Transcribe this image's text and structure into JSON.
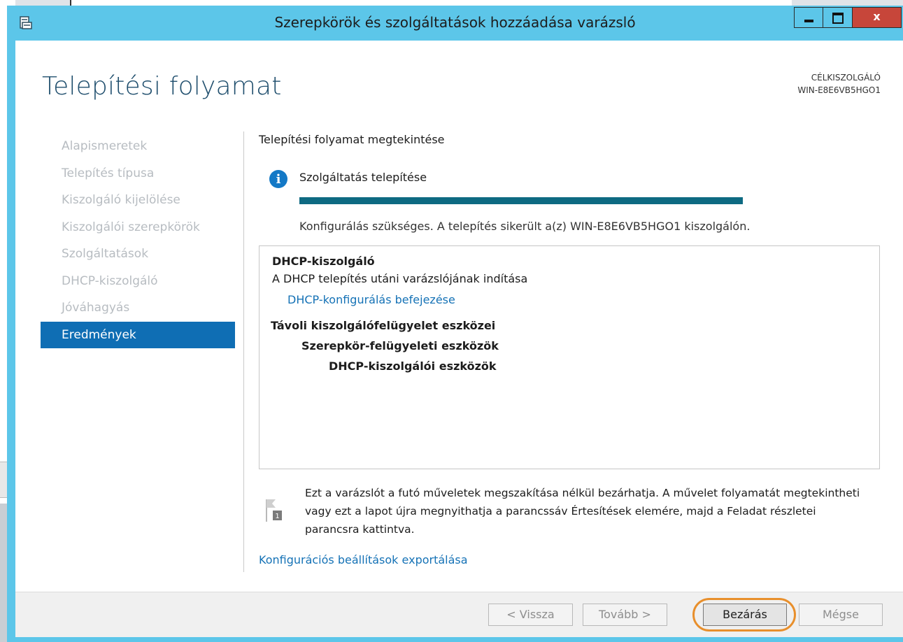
{
  "window": {
    "title": "Szerepkörök és szolgáltatások hozzáadása varázsló",
    "close_glyph": "x"
  },
  "page": {
    "heading": "Telepítési folyamat",
    "target_label": "CÉLKISZOLGÁLÓ",
    "target_server": "WIN-E8E6VB5HGO1"
  },
  "nav": {
    "items": [
      {
        "label": "Alapismeretek"
      },
      {
        "label": "Telepítés típusa"
      },
      {
        "label": "Kiszolgáló kijelölése"
      },
      {
        "label": "Kiszolgálói szerepkörök"
      },
      {
        "label": "Szolgáltatások"
      },
      {
        "label": "DHCP-kiszolgáló"
      },
      {
        "label": "Jóváhagyás"
      },
      {
        "label": "Eredmények"
      }
    ],
    "active_index": 7
  },
  "progress": {
    "section_title": "Telepítési folyamat megtekintése",
    "status": "Szolgáltatás telepítése",
    "fraction": 1.0,
    "result": "Konfigurálás szükséges. A telepítés sikerült a(z) WIN-E8E6VB5HGO1 kiszolgálón."
  },
  "results": {
    "dhcp_server": "DHCP-kiszolgáló",
    "post_install": "A DHCP telepítés utáni varázslójának indítása",
    "config_link": "DHCP-konfigurálás befejezése",
    "rsat": "Távoli kiszolgálófelügyelet eszközei",
    "role_tools": "Szerepkör-felügyeleti eszközök",
    "dhcp_tools": "DHCP-kiszolgálói eszközök"
  },
  "note": {
    "text": "Ezt a varázslót a futó műveletek megszakítása nélkül bezárhatja. A művelet folyamatát megtekintheti vagy ezt a lapot újra megnyithatja a parancssáv Értesítések elemére, majd a Feladat részletei parancsra kattintva.",
    "flag_badge": "1"
  },
  "export_link": "Konfigurációs beállítások exportálása",
  "footer": {
    "back": "< Vissza",
    "next": "Tovább >",
    "close": "Bezárás",
    "cancel": "Mégse"
  },
  "colors": {
    "title_bar": "#5cc6e9",
    "accent": "#0f6eb4",
    "progress": "#0e6a82",
    "link": "#1572b6",
    "highlight": "#e88f2c"
  }
}
